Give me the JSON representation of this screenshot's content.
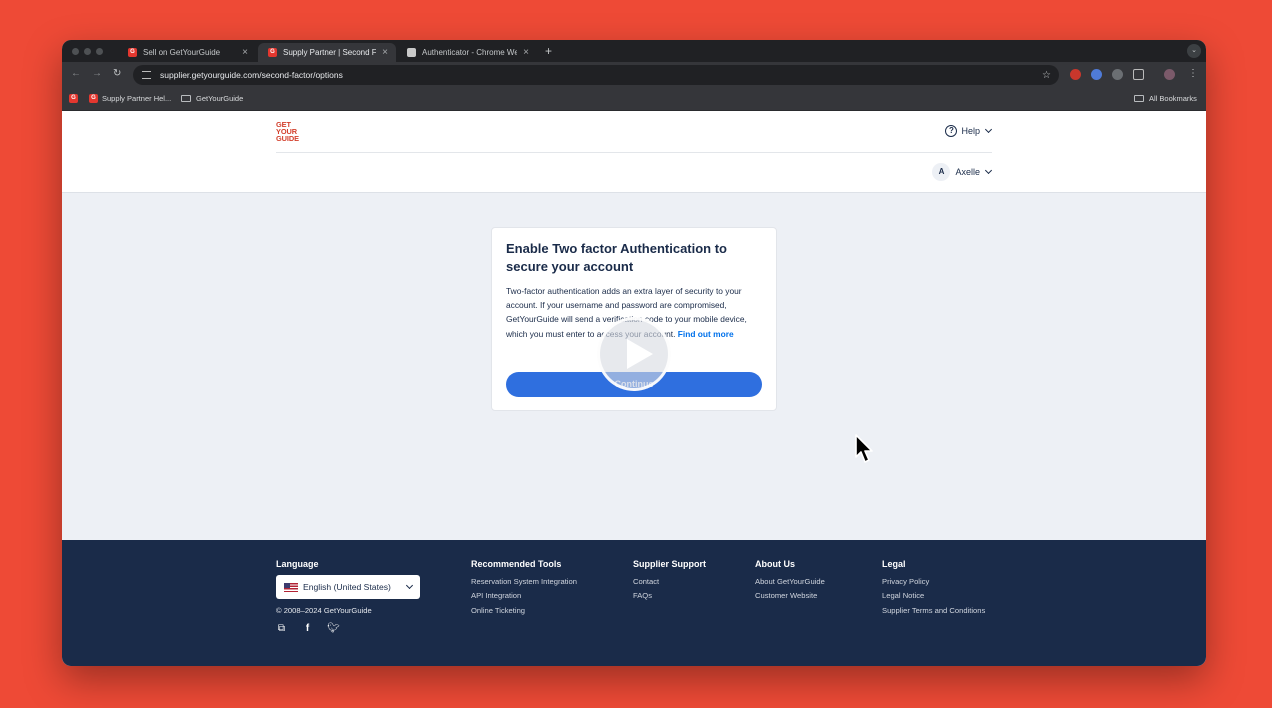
{
  "browser": {
    "tabs": [
      {
        "title": "Sell on GetYourGuide",
        "favicon": "getyourguide-icon"
      },
      {
        "title": "Supply Partner | Second Fact",
        "favicon": "getyourguide-icon"
      },
      {
        "title": "Authenticator - Chrome Web",
        "favicon": "authenticator-icon"
      }
    ],
    "address": "supplier.getyourguide.com/second-factor/options",
    "bookmarks": [
      {
        "label": "Supply Partner Hel..."
      },
      {
        "label": "GetYourGuide"
      }
    ],
    "all_bookmarks_label": "All Bookmarks"
  },
  "site": {
    "logo_lines": [
      "GET",
      "YOUR",
      "GUIDE"
    ],
    "help_label": "Help",
    "user_initial": "A",
    "user_name": "Axelle"
  },
  "card": {
    "title": "Enable Two factor Authentication to secure your account",
    "body": "Two-factor authentication adds an extra layer of security to your account. If your username and password are compromised, GetYourGuide will send a verification code to your mobile device, which you must enter to access your account. ",
    "link": "Find out more",
    "button": "Continue"
  },
  "footer": {
    "language": {
      "heading": "Language",
      "selected": "English (United States)"
    },
    "copyright": "© 2008–2024 GetYourGuide",
    "columns": [
      {
        "heading": "Recommended Tools",
        "links": [
          "Reservation System Integration",
          "API Integration",
          "Online Ticketing"
        ]
      },
      {
        "heading": "Supplier Support",
        "links": [
          "Contact",
          "FAQs"
        ]
      },
      {
        "heading": "About Us",
        "links": [
          "About GetYourGuide",
          "Customer Website"
        ]
      },
      {
        "heading": "Legal",
        "links": [
          "Privacy Policy",
          "Legal Notice",
          "Supplier Terms and Conditions"
        ]
      }
    ],
    "social_icons": [
      "external-link-icon",
      "facebook-icon",
      "twitter-icon"
    ]
  },
  "colors": {
    "background": "#ee4a36",
    "brand_red": "#d3402d",
    "navy": "#1a2b49",
    "primary_button": "#2f6fdf"
  }
}
